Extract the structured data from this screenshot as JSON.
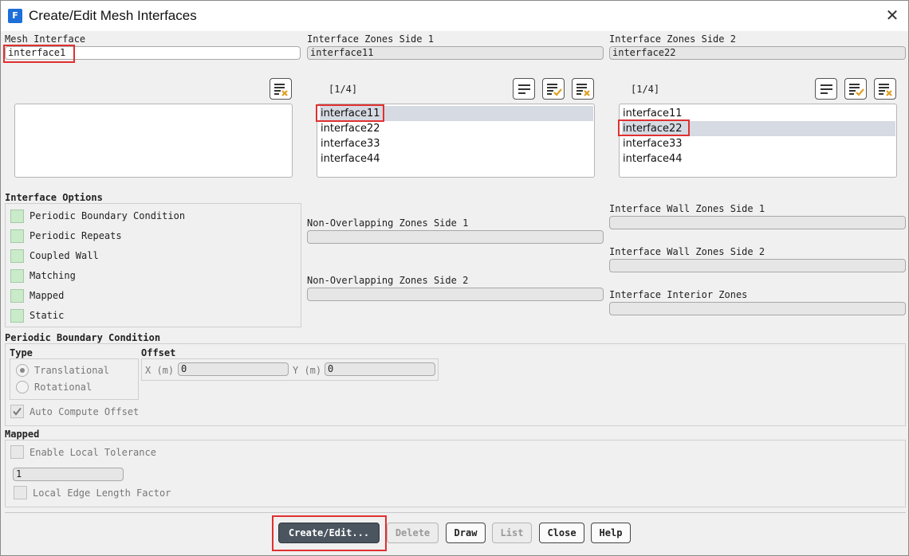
{
  "window": {
    "title": "Create/Edit Mesh Interfaces",
    "app_icon_letter": "F"
  },
  "mesh_interface": {
    "label": "Mesh Interface",
    "value": "interface1"
  },
  "zones_side1": {
    "label": "Interface Zones Side 1",
    "value": "interface11",
    "counter": "[1/4]",
    "items": [
      "interface11",
      "interface22",
      "interface33",
      "interface44"
    ],
    "selected_index": 0
  },
  "zones_side2": {
    "label": "Interface Zones Side 2",
    "value": "interface22",
    "counter": "[1/4]",
    "items": [
      "interface11",
      "interface22",
      "interface33",
      "interface44"
    ],
    "selected_index": 1
  },
  "interface_options": {
    "title": "Interface Options",
    "items": [
      "Periodic Boundary Condition",
      "Periodic Repeats",
      "Coupled Wall",
      "Matching",
      "Mapped",
      "Static"
    ]
  },
  "non_overlapping": {
    "side1_label": "Non-Overlapping Zones Side 1",
    "side2_label": "Non-Overlapping Zones Side 2"
  },
  "wall_zones": {
    "side1_label": "Interface Wall Zones Side 1",
    "side2_label": "Interface Wall Zones Side 2",
    "interior_label": "Interface Interior Zones"
  },
  "periodic": {
    "title": "Periodic Boundary Condition",
    "type_label": "Type",
    "translational": "Translational",
    "rotational": "Rotational",
    "offset_label": "Offset",
    "x_label": "X (m)",
    "x_value": "0",
    "y_label": "Y (m)",
    "y_value": "0",
    "auto_compute": "Auto Compute Offset"
  },
  "mapped": {
    "title": "Mapped",
    "enable_tolerance": "Enable Local Tolerance",
    "tolerance_value": "1",
    "edge_length_factor": "Local Edge Length Factor"
  },
  "buttons": {
    "create_edit": "Create/Edit...",
    "delete": "Delete",
    "draw": "Draw",
    "list": "List",
    "close": "Close",
    "help": "Help"
  },
  "colors": {
    "checkbox_green": "#c9ebc9",
    "highlight_red": "#e03030",
    "primary_button": "#4b5560",
    "selection": "#d6dae2"
  }
}
